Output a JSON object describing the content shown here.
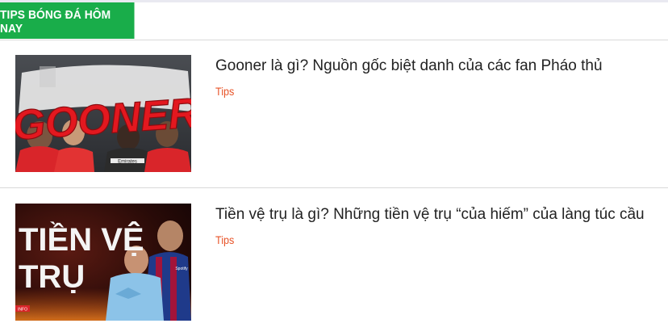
{
  "section": {
    "title": "TIPS BÓNG ĐÁ HÔM NAY"
  },
  "articles": [
    {
      "title": "Gooner là gì? Nguồn gốc biệt danh của các fan Pháo thủ",
      "category": "Tips",
      "thumbnail": {
        "caption_text": "GOONER",
        "sponsor_text": "Emirates"
      }
    },
    {
      "title": "Tiền vệ trụ là gì? Những tiền vệ trụ “của hiếm” của làng túc cầu",
      "category": "Tips",
      "thumbnail": {
        "caption_line1": "TIỀN VỆ",
        "caption_line2": "TRỤ",
        "badge_text": "INFO",
        "sponsor_text": "Spotify"
      }
    }
  ],
  "colors": {
    "header_green": "#19ad4a",
    "category_orange": "#e8552a",
    "divider": "#d9d9d9"
  }
}
